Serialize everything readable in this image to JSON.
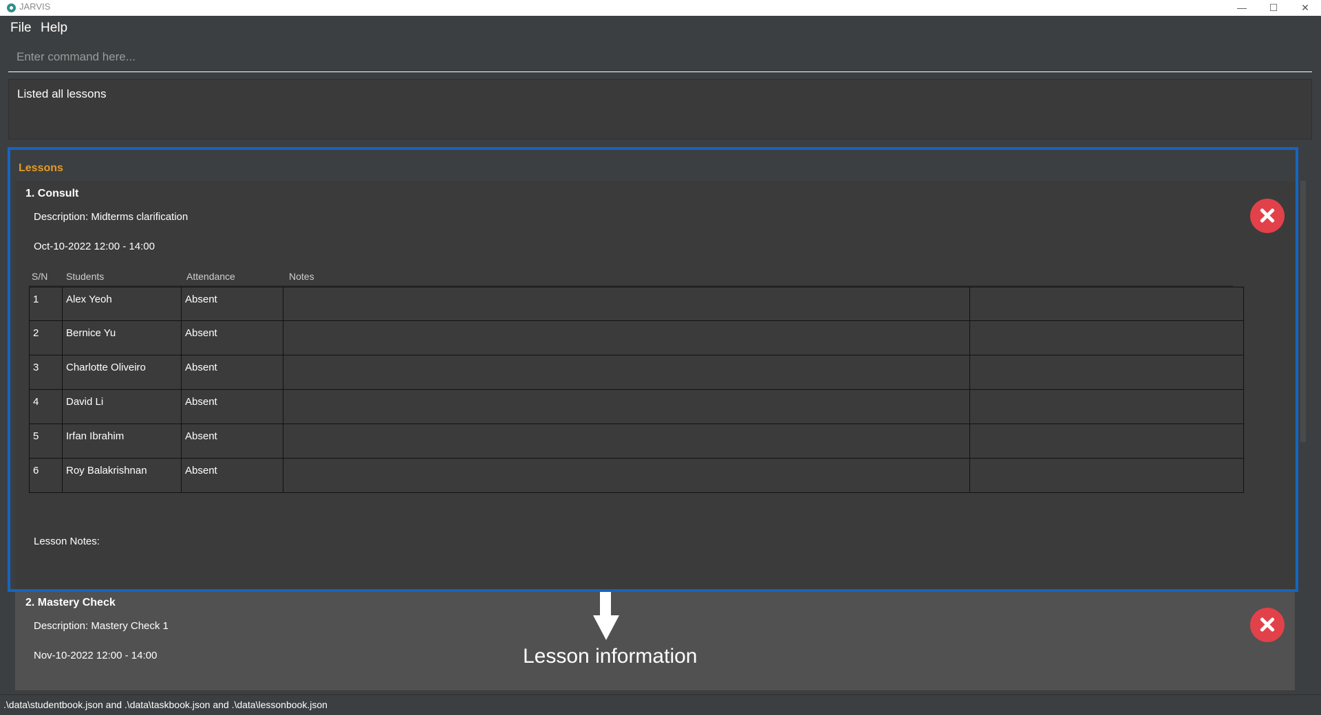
{
  "window": {
    "title": "JARVIS"
  },
  "menu": {
    "file": "File",
    "help": "Help"
  },
  "command": {
    "placeholder": "Enter command here...",
    "value": ""
  },
  "result": {
    "message": "Listed all lessons"
  },
  "lessons": {
    "header": "Lessons",
    "columns": {
      "sn": "S/N",
      "students": "Students",
      "attendance": "Attendance",
      "notes": "Notes"
    },
    "items": [
      {
        "title": "1.  Consult",
        "description": "Description: Midterms clarification",
        "datetime": "Oct-10-2022 12:00 - 14:00",
        "students": [
          {
            "sn": "1",
            "name": "Alex Yeoh",
            "attendance": "Absent"
          },
          {
            "sn": "2",
            "name": "Bernice Yu",
            "attendance": "Absent"
          },
          {
            "sn": "3",
            "name": "Charlotte Oliveiro",
            "attendance": "Absent"
          },
          {
            "sn": "4",
            "name": "David Li",
            "attendance": "Absent"
          },
          {
            "sn": "5",
            "name": "Irfan Ibrahim",
            "attendance": "Absent"
          },
          {
            "sn": "6",
            "name": "Roy Balakrishnan",
            "attendance": "Absent"
          }
        ],
        "lesson_notes": "Lesson Notes:"
      },
      {
        "title": "2.  Mastery Check",
        "description": "Description: Mastery Check 1",
        "datetime": "Nov-10-2022 12:00 - 14:00"
      }
    ]
  },
  "annotation": {
    "label": "Lesson information"
  },
  "status": {
    "text": ".\\data\\studentbook.json and .\\data\\taskbook.json and .\\data\\lessonbook.json"
  },
  "colors": {
    "accent": "#e69a25",
    "highlight": "#1565c0",
    "delete": "#e2414a"
  }
}
